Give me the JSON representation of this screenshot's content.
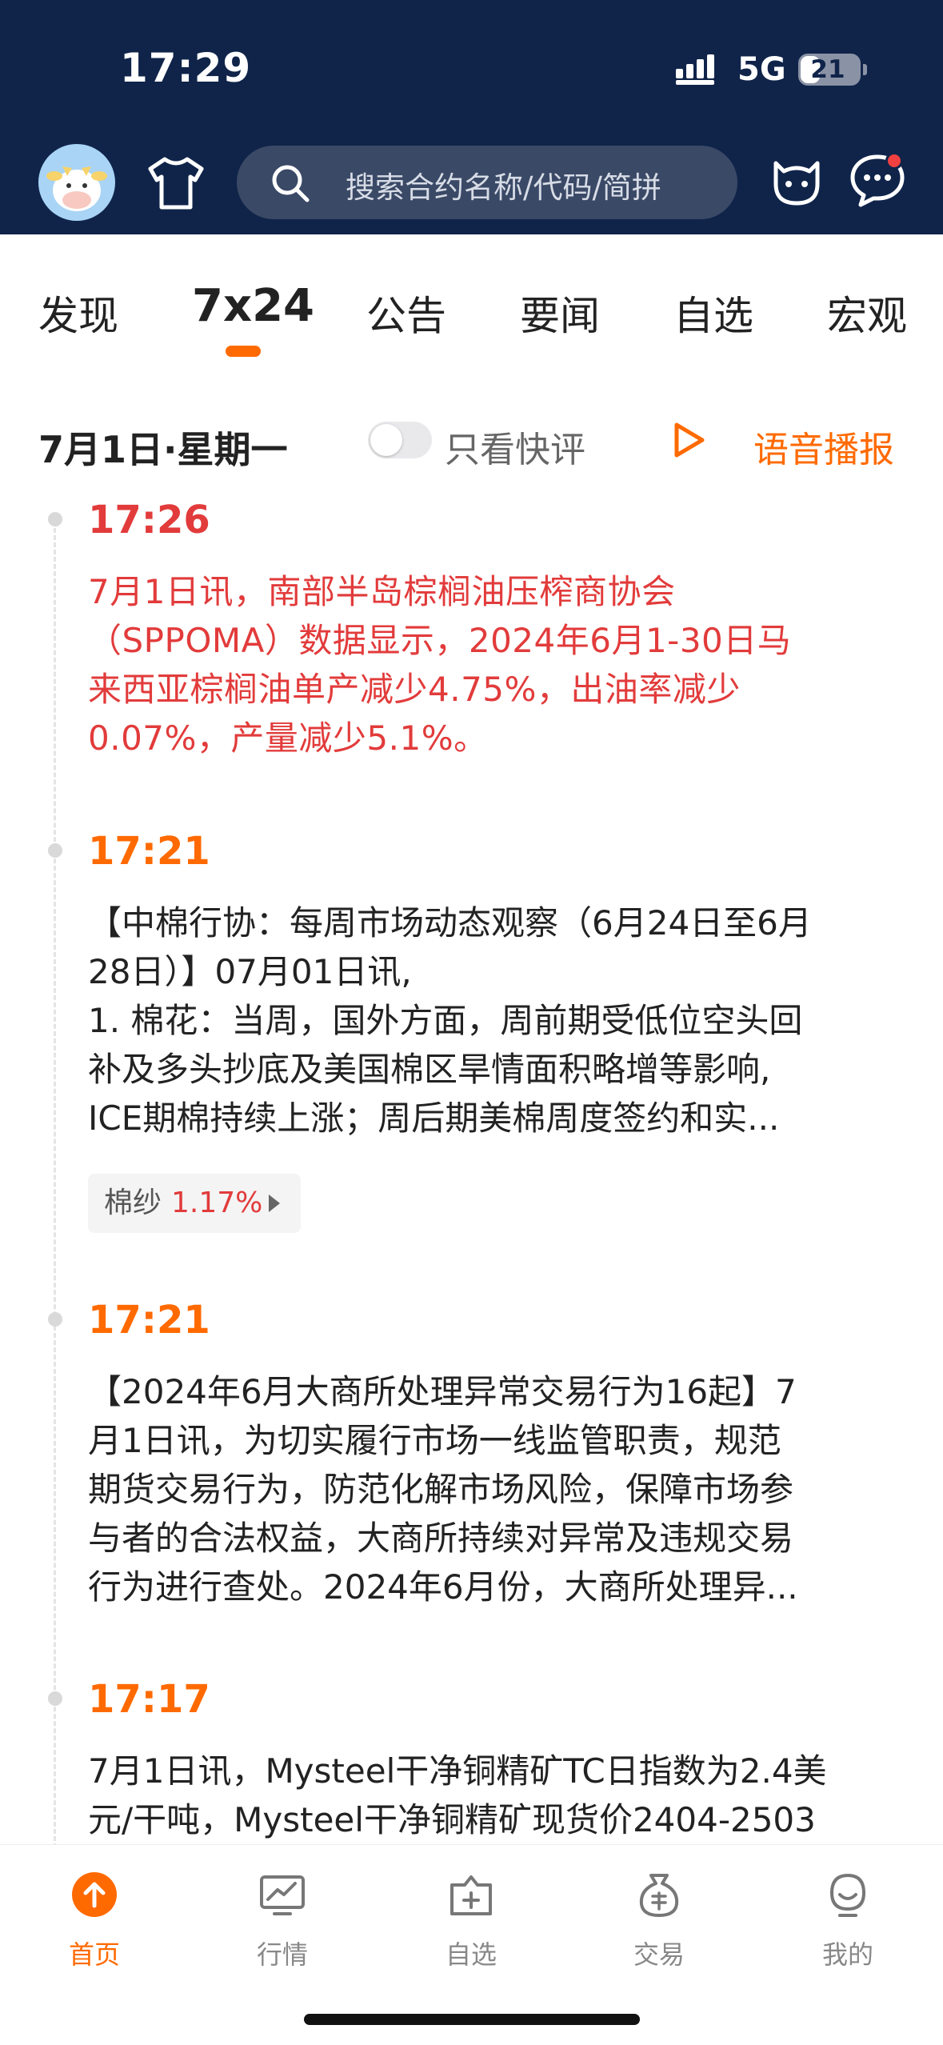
{
  "status_bar": {
    "time": "17:29",
    "network": "5G",
    "battery": "21"
  },
  "header": {
    "search_placeholder": "搜索合约名称/代码/简拼"
  },
  "tabs": [
    {
      "label": "发现"
    },
    {
      "label": "7x24",
      "active": true
    },
    {
      "label": "公告"
    },
    {
      "label": "要闻"
    },
    {
      "label": "自选"
    },
    {
      "label": "宏观"
    }
  ],
  "date_bar": {
    "date": "7月1日·星期一",
    "toggle_label": "只看快评",
    "toggle_on": false,
    "voice_label": "语音播报"
  },
  "news": [
    {
      "time": "17:26",
      "highlight": true,
      "lines": [
        "7月1日讯，南部半岛棕榈油压榨商协会",
        "（SPPOMA）数据显示，2024年6月1-30日马",
        "来西亚棕榈油单产减少4.75%，出油率减少",
        "0.07%，产量减少5.1%。"
      ]
    },
    {
      "time": "17:21",
      "highlight": false,
      "lines": [
        "【中棉行协：每周市场动态观察（6月24日至6月",
        "28日）】07月01日讯,",
        " 1. 棉花：当周，国外方面，周前期受低位空头回",
        "补及多头抄底及美国棉区旱情面积略增等影响,",
        "ICE期棉持续上涨；周后期美棉周度签约和实..."
      ],
      "tag": {
        "name": "棉纱",
        "change": "1.17%"
      }
    },
    {
      "time": "17:21",
      "highlight": false,
      "lines": [
        "【2024年6月大商所处理异常交易行为16起】7",
        "月1日讯，为切实履行市场一线监管职责，规范",
        "期货交易行为，防范化解市场风险，保障市场参",
        "与者的合法权益，大商所持续对异常及违规交易",
        "行为进行查处。2024年6月份，大商所处理异..."
      ]
    },
    {
      "time": "17:17",
      "highlight": false,
      "lines": [
        "7月1日讯，Mysteel干净铜精矿TC日指数为2.4美",
        "元/干吨，Mysteel干净铜精矿现货价2404-2503"
      ]
    }
  ],
  "bottom_nav": [
    {
      "label": "首页",
      "icon": "home-icon",
      "active": true
    },
    {
      "label": "行情",
      "icon": "market-icon"
    },
    {
      "label": "自选",
      "icon": "watchlist-icon"
    },
    {
      "label": "交易",
      "icon": "trade-icon"
    },
    {
      "label": "我的",
      "icon": "profile-icon"
    }
  ],
  "colors": {
    "header_bg": "#10244a",
    "accent": "#ff6a00",
    "highlight_red": "#e23b3b"
  }
}
